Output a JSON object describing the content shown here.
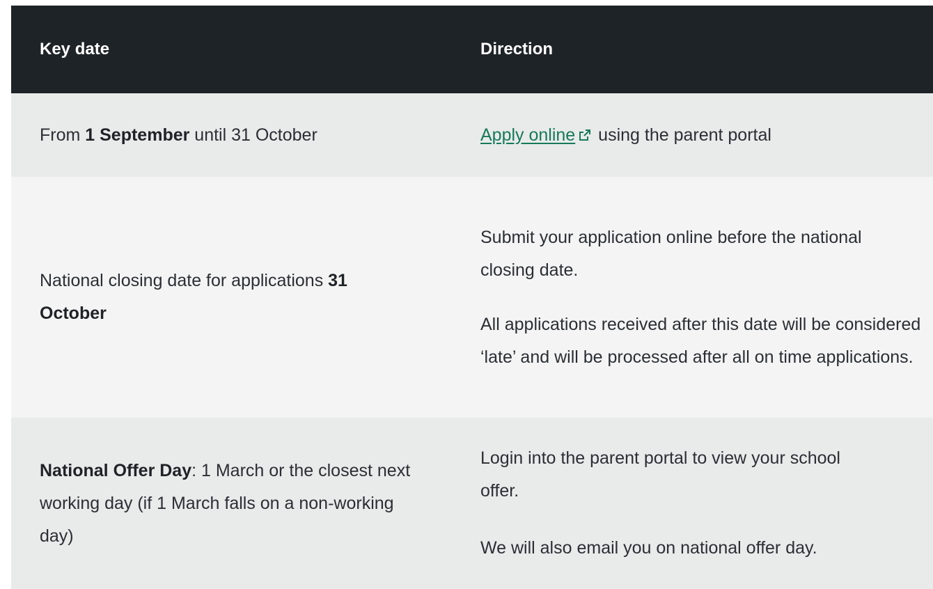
{
  "header": {
    "col1": "Key date",
    "col2": "Direction"
  },
  "rows": [
    {
      "key": {
        "prefix": "From ",
        "bold": "1 September",
        "suffix": " until 31 October"
      },
      "direction": {
        "link_text": "Apply online",
        "link_icon": "external-link-icon",
        "after_link": " using the parent portal"
      }
    },
    {
      "key": {
        "prefix": "National closing date for applications ",
        "bold": "31 October"
      },
      "direction": {
        "p1": "Submit your application online before the national closing date.",
        "p2": "All applications received after this date will be considered ‘late’ and will be processed after all on time applications."
      }
    },
    {
      "key": {
        "bold": "National Offer Day",
        "suffix": ": 1 March or the closest next working day (if 1 March falls on a non-working day)"
      },
      "direction": {
        "p1": "Login into the parent portal to view your school offer.",
        "p2": "We will also email you on national offer day."
      }
    }
  ],
  "colors": {
    "header_bg": "#1e2327",
    "row_shaded": "#e9eaea",
    "row_light": "#f4f4f4",
    "link": "#167a5a"
  }
}
